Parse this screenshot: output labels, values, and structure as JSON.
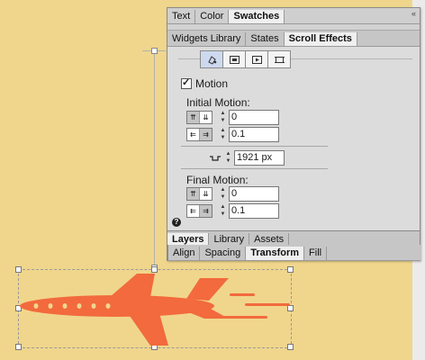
{
  "panel": {
    "top_tabs": [
      "Text",
      "Color",
      "Swatches"
    ],
    "top_active": "Swatches",
    "second_tabs": [
      "Widgets Library",
      "States",
      "Scroll Effects"
    ],
    "second_active": "Scroll Effects",
    "collapse_icon": "«",
    "icon_buttons": [
      "fill-effect-icon",
      "slideshow-effect-icon",
      "video-effect-icon",
      "crop-effect-icon"
    ],
    "motion": {
      "label": "Motion",
      "checked": true
    },
    "initial_motion": {
      "label": "Initial Motion:",
      "direction_up_down_value": "0",
      "direction_left_right_value": "0.1"
    },
    "key_position_value": "1921 px",
    "final_motion": {
      "label": "Final Motion:",
      "direction_up_down_value": "0",
      "direction_left_right_value": "0.1"
    },
    "help_glyph": "?"
  },
  "bottom_panel": {
    "tabs_row1": [
      "Layers",
      "Library",
      "Assets"
    ],
    "active_row1": "Layers",
    "tabs_row2": [
      "Align",
      "Spacing",
      "Transform",
      "Fill"
    ],
    "active_row2": "Transform"
  },
  "colors": {
    "canvas": "#f0d68c",
    "plane": "#f26a3d",
    "panel": "#dcdcdc"
  }
}
